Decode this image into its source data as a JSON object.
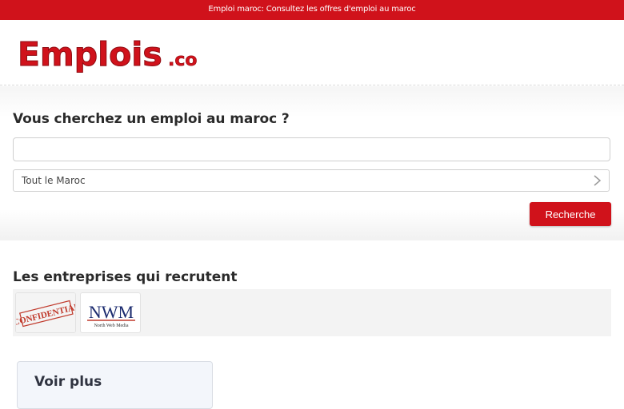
{
  "topbar": {
    "text": "Emploi maroc: Consultez les offres d'emploi au maroc"
  },
  "header": {
    "logo_text": "Emplois",
    "logo_suffix": ".co"
  },
  "search": {
    "title": "Vous cherchez un emploi au maroc ?",
    "keyword_value": "",
    "region_value": "Tout le Maroc",
    "button_label": "Recherche"
  },
  "companies": {
    "title": "Les entreprises qui recrutent",
    "items": [
      {
        "name": "CONFIDENTIAL"
      },
      {
        "name": "NWM",
        "tagline": "North Web Media"
      }
    ]
  },
  "more": {
    "label": "Voir plus"
  },
  "colors": {
    "brand_red": "#d0121b",
    "text": "#2a2a2a"
  }
}
